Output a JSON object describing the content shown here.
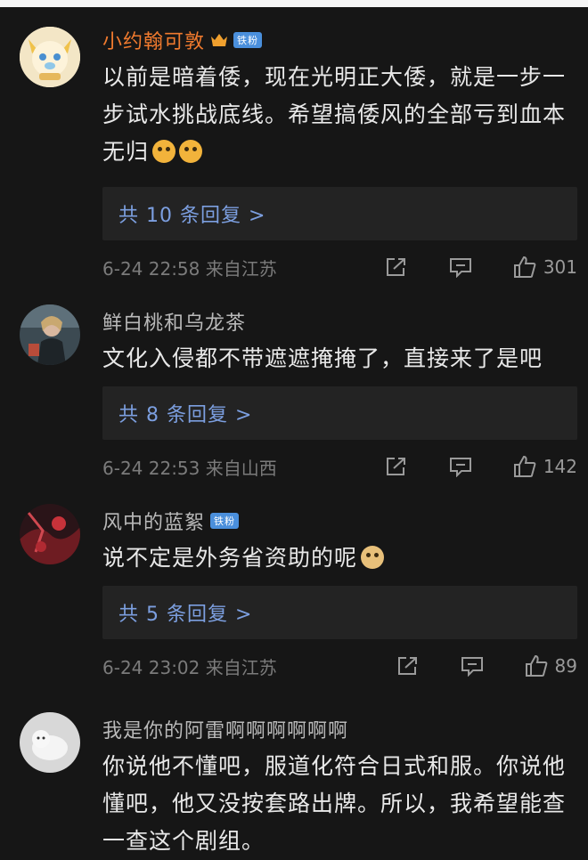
{
  "comments": [
    {
      "username": "小约翰可敦",
      "badge": "铁粉",
      "text": "以前是暗着倭，现在光明正大倭，就是一步一步试水挑战底线。希望搞倭风的全部亏到血本无归",
      "reply_label": "共 10 条回复 >",
      "time_location": "6-24 22:58 来自江苏",
      "likes": "301"
    },
    {
      "username": "鲜白桃和乌龙茶",
      "text": "文化入侵都不带遮遮掩掩了，直接来了是吧",
      "reply_label": "共 8 条回复 >",
      "time_location": "6-24 22:53 来自山西",
      "likes": "142"
    },
    {
      "username": "风中的蓝絮",
      "badge": "铁粉",
      "text": "说不定是外务省资助的呢",
      "reply_label": "共 5 条回复 >",
      "time_location": "6-24 23:02 来自江苏",
      "likes": "89"
    },
    {
      "username": "我是你的阿雷啊啊啊啊啊啊",
      "text": "你说他不懂吧，服道化符合日式和服。你说他懂吧，他又没按套路出牌。所以，我希望能查一查这个剧组。"
    }
  ],
  "icons": {
    "share": "share-icon",
    "comment": "comment-icon",
    "like": "thumbs-up-icon"
  },
  "colors": {
    "vip_name": "#f07a2e",
    "reply_link": "#7c9fe0",
    "badge": "#4a8fdc",
    "background": "#161616"
  }
}
